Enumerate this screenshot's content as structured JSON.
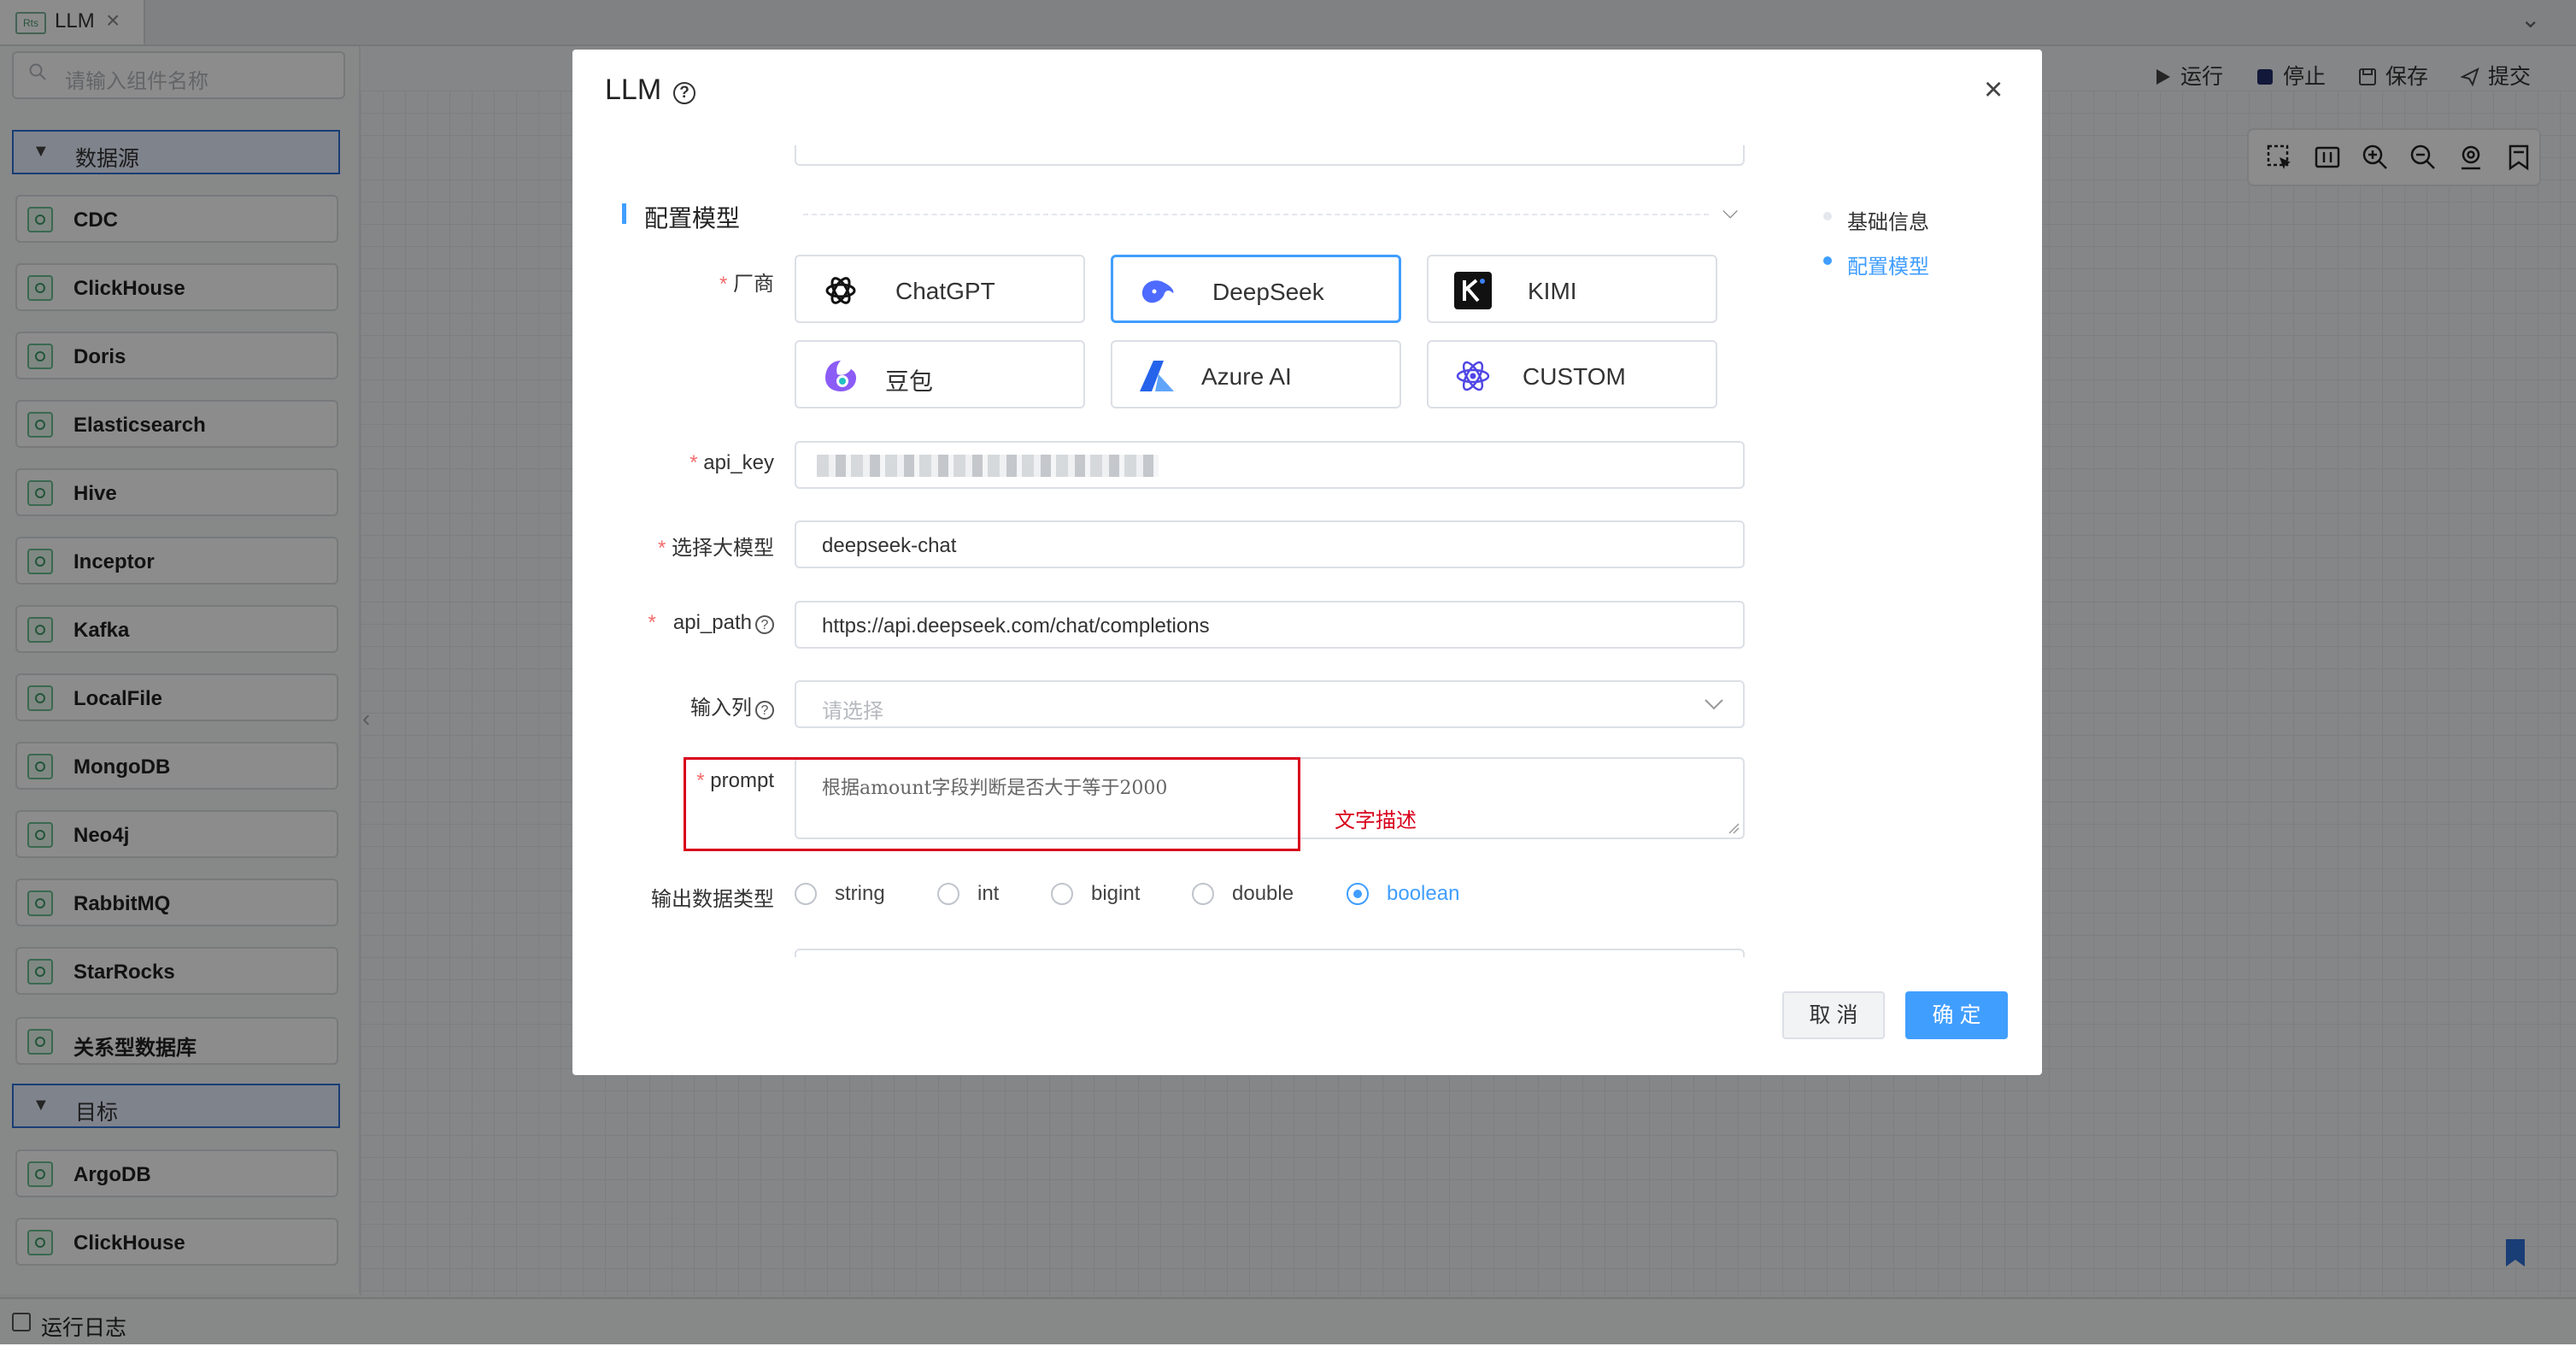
{
  "tab": {
    "logo_text": "Rts",
    "title": "LLM"
  },
  "sidebar": {
    "search_placeholder": "请输入组件名称",
    "group_source": "数据源",
    "sources": [
      "CDC",
      "ClickHouse",
      "Doris",
      "Elasticsearch",
      "Hive",
      "Inceptor",
      "Kafka",
      "LocalFile",
      "MongoDB",
      "Neo4j",
      "RabbitMQ",
      "StarRocks",
      "关系型数据库"
    ],
    "group_target": "目标",
    "targets": [
      "ArgoDB",
      "ClickHouse"
    ]
  },
  "toolbar": {
    "run": "运行",
    "stop": "停止",
    "save": "保存",
    "submit": "提交"
  },
  "bottom": {
    "log": "运行日志"
  },
  "modal": {
    "title": "LLM",
    "section_title": "配置模型",
    "anchors": [
      "基础信息",
      "配置模型"
    ],
    "vendor_label": "厂商",
    "vendors": [
      "ChatGPT",
      "DeepSeek",
      "KIMI",
      "豆包",
      "Azure AI",
      "CUSTOM"
    ],
    "selected_vendor": "DeepSeek",
    "api_key_label": "api_key",
    "model_label": "选择大模型",
    "model_value": "deepseek-chat",
    "api_path_label": "api_path",
    "api_path_value": "https://api.deepseek.com/chat/completions",
    "input_col_label": "输入列",
    "input_col_placeholder": "请选择",
    "prompt_label": "prompt",
    "prompt_value": "根据amount字段判断是否大于等于2000",
    "annotation": "文字描述",
    "output_type_label": "输出数据类型",
    "output_types": [
      "string",
      "int",
      "bigint",
      "double",
      "boolean"
    ],
    "selected_output": "boolean",
    "cancel": "取 消",
    "confirm": "确 定"
  },
  "colors": {
    "primary": "#409eff",
    "required": "#f56c6c",
    "highlight": "#d9001b"
  }
}
